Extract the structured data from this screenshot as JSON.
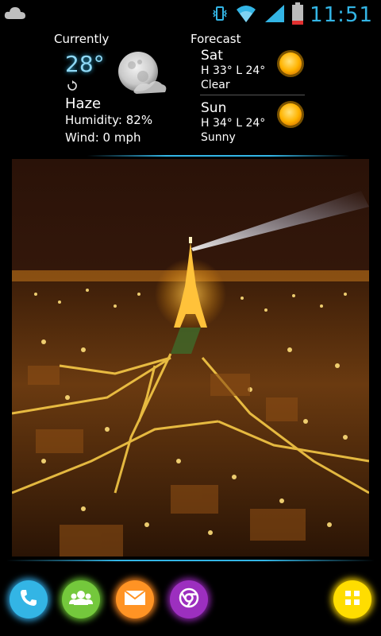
{
  "status_bar": {
    "time": "11:51",
    "icons": [
      "weather-cloud-icon",
      "vibrate-icon",
      "wifi-icon",
      "signal-icon",
      "battery-icon"
    ],
    "accent_color": "#33b5e5",
    "battery_level": 0.2
  },
  "weather": {
    "currently_label": "Currently",
    "forecast_label": "Forecast",
    "temperature": "28°",
    "condition": "Haze",
    "humidity": "Humidity: 82%",
    "wind": "Wind: 0 mph",
    "forecast": [
      {
        "day": "Sat",
        "high_low": "H 33° L 24°",
        "desc": "Clear",
        "icon": "sun-icon"
      },
      {
        "day": "Sun",
        "high_low": "H 34° L 24°",
        "desc": "Sunny",
        "icon": "sun-icon"
      }
    ]
  },
  "photo": {
    "icon": "paris-night-photo"
  },
  "dock": {
    "buttons": [
      {
        "name": "phone",
        "color": "#33b5e5"
      },
      {
        "name": "people",
        "color": "#74c83c"
      },
      {
        "name": "email",
        "color": "#ff9324"
      },
      {
        "name": "chrome",
        "color": "#9c2fbf"
      },
      {
        "name": "app-drawer",
        "color": "#ffdd00"
      }
    ]
  }
}
